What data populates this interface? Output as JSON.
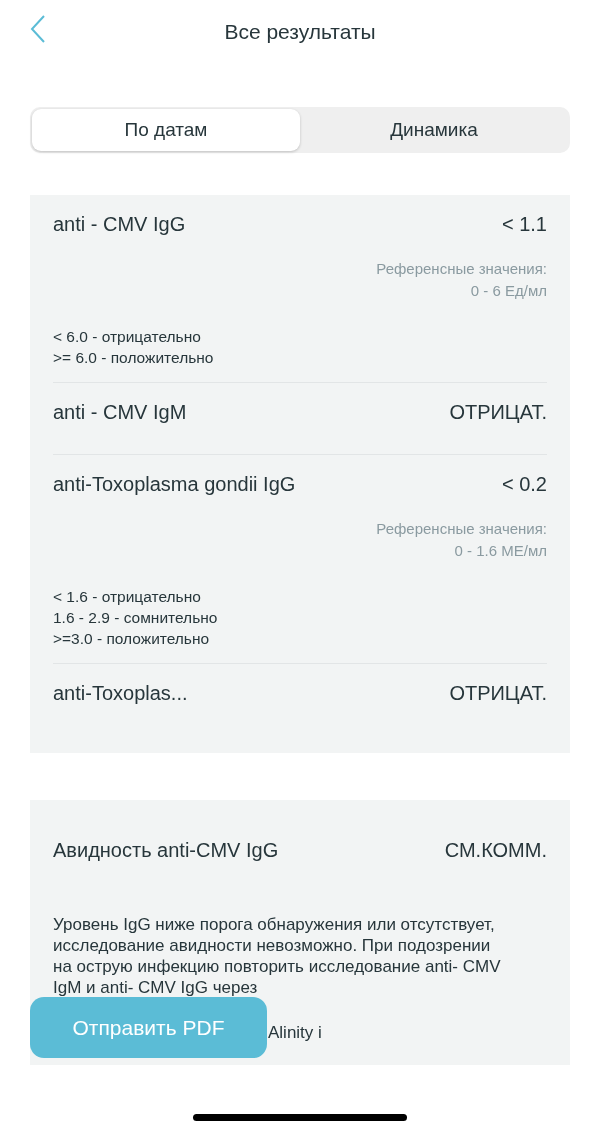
{
  "header": {
    "title": "Все результаты"
  },
  "tabs": [
    {
      "label": "По датам",
      "selected": true
    },
    {
      "label": "Динамика",
      "selected": false
    }
  ],
  "results": [
    {
      "kind": "detailed",
      "name": "anti - CMV IgG",
      "value": "< 1.1",
      "reference_label": "Референсные значения:",
      "reference_range": "0 - 6 Ед/мл",
      "interpretation": [
        "< 6.0 - отрицательно",
        ">= 6.0 - положительно"
      ]
    },
    {
      "kind": "simple",
      "name": "anti - CMV IgM",
      "value": "ОТРИЦАТ."
    },
    {
      "kind": "detailed",
      "name": "anti-Toxoplasma gondii IgG",
      "value": "< 0.2",
      "reference_label": "Референсные значения:",
      "reference_range": "0 - 1.6 МЕ/мл",
      "interpretation": [
        "< 1.6 - отрицательно",
        "1.6 - 2.9 - сомнительно",
        ">=3.0 - положительно"
      ]
    },
    {
      "kind": "simple",
      "name": "anti-Toxoplas...",
      "value": "ОТРИЦАТ."
    }
  ],
  "avidity": {
    "name": "Авидность anti-CMV IgG",
    "value": "СМ.КОММ.",
    "comment": "Уровень IgG ниже порога обнаружения или отсутствует, исследование авидности невозможно. При подозрении на острую инфекцию повторить исследование anti- CMV IgM и anti- CMV IgG через",
    "comment_tail": "Alinity i"
  },
  "send_button": "Отправить PDF"
}
